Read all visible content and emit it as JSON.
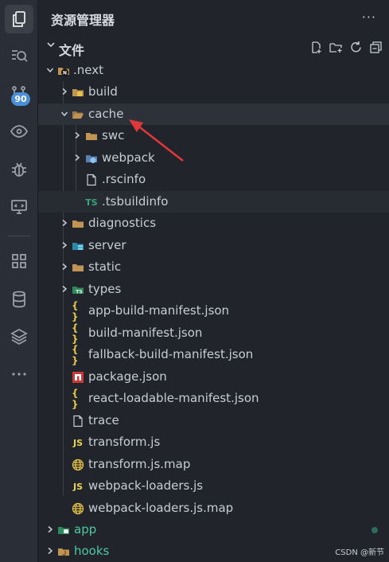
{
  "sidebar": {
    "title": "资源管理器",
    "more": "···",
    "section_label": "文件"
  },
  "activity": {
    "scm_badge": "90",
    "items": [
      "explorer-icon",
      "search-icon",
      "source-control-icon",
      "preview-icon",
      "debug-icon",
      "remote-display-icon",
      "extensions-grid-icon",
      "database-icon",
      "layers-icon",
      "more-icon"
    ]
  },
  "tree": {
    "next": ".next",
    "build": "build",
    "cache": "cache",
    "swc": "swc",
    "webpack": "webpack",
    "rscinfo": ".rscinfo",
    "tsbuildinfo": ".tsbuildinfo",
    "diagnostics": "diagnostics",
    "server": "server",
    "static": "static",
    "types": "types",
    "app_build_manifest": "app-build-manifest.json",
    "build_manifest": "build-manifest.json",
    "fallback_build_manifest": "fallback-build-manifest.json",
    "package_json": "package.json",
    "react_loadable_manifest": "react-loadable-manifest.json",
    "trace": "trace",
    "transform_js": "transform.js",
    "transform_js_map": "transform.js.map",
    "webpack_loaders_js": "webpack-loaders.js",
    "webpack_loaders_js_map": "webpack-loaders.js.map",
    "app": "app",
    "hooks": "hooks"
  },
  "icon_text": {
    "json": "{ }",
    "js": "JS",
    "ts": "TS"
  },
  "watermark": "CSDN @新节",
  "colors": {
    "folder": "#c09553",
    "json": "#e8c547",
    "js": "#e8d44d",
    "ts": "#3aa57a",
    "green_folder_label": "#4ec9a0",
    "arrow": "#e0383a"
  }
}
